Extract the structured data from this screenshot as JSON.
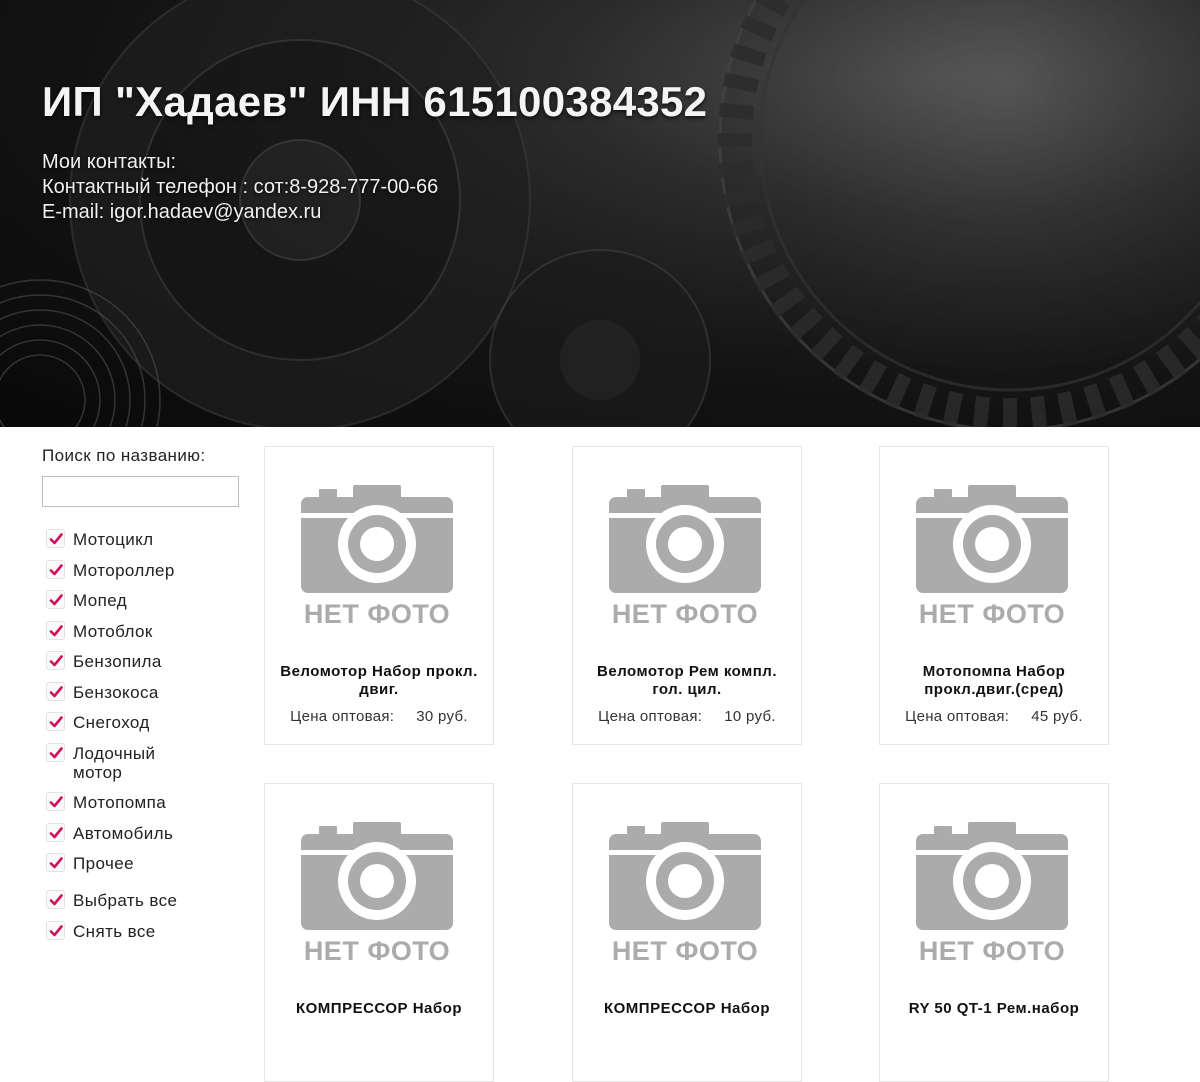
{
  "header": {
    "title": "ИП \"Хадаев\" ИНН 615100384352",
    "contacts_heading": "Мои контакты:",
    "phone_line": "Контактный телефон : сот:8-928-777-00-66",
    "email_line": "E-mail: igor.hadaev@yandex.ru"
  },
  "sidebar": {
    "search_label": "Поиск по названию:",
    "search_value": "",
    "search_placeholder": "",
    "filters": [
      {
        "label": "Мотоцикл",
        "checked": true
      },
      {
        "label": "Мотороллер",
        "checked": true
      },
      {
        "label": "Мопед",
        "checked": true
      },
      {
        "label": "Мотоблок",
        "checked": true
      },
      {
        "label": "Бензопила",
        "checked": true
      },
      {
        "label": "Бензокоса",
        "checked": true
      },
      {
        "label": "Снегоход",
        "checked": true
      },
      {
        "label": "Лодочный мотор",
        "checked": true
      },
      {
        "label": "Мотопомпа",
        "checked": true
      },
      {
        "label": "Автомобиль",
        "checked": true
      },
      {
        "label": "Прочее",
        "checked": true
      }
    ],
    "select_all_label": "Выбрать все",
    "deselect_all_label": "Снять все",
    "check_color": "#d0105c"
  },
  "products": [
    {
      "name": "Веломотор Набор прокл. двиг.",
      "price_label": "Цена оптовая:",
      "price": "30 руб.",
      "nophoto": "НЕТ ФОТО"
    },
    {
      "name": "Веломотор Рем компл. гол. цил.",
      "price_label": "Цена оптовая:",
      "price": "10 руб.",
      "nophoto": "НЕТ ФОТО"
    },
    {
      "name": "Мотопомпа Набор прокл.двиг.(сред)",
      "price_label": "Цена оптовая:",
      "price": "45 руб.",
      "nophoto": "НЕТ ФОТО"
    },
    {
      "name": "КОМПРЕССОР Набор",
      "price_label": "",
      "price": "",
      "nophoto": "НЕТ ФОТО"
    },
    {
      "name": "КОМПРЕССОР Набор",
      "price_label": "",
      "price": "",
      "nophoto": "НЕТ ФОТО"
    },
    {
      "name": "RY 50 QT-1 Рем.набор",
      "price_label": "",
      "price": "",
      "nophoto": "НЕТ ФОТО"
    }
  ],
  "colors": {
    "placeholder_gray": "#ababab",
    "card_border": "#e6e6e6"
  }
}
